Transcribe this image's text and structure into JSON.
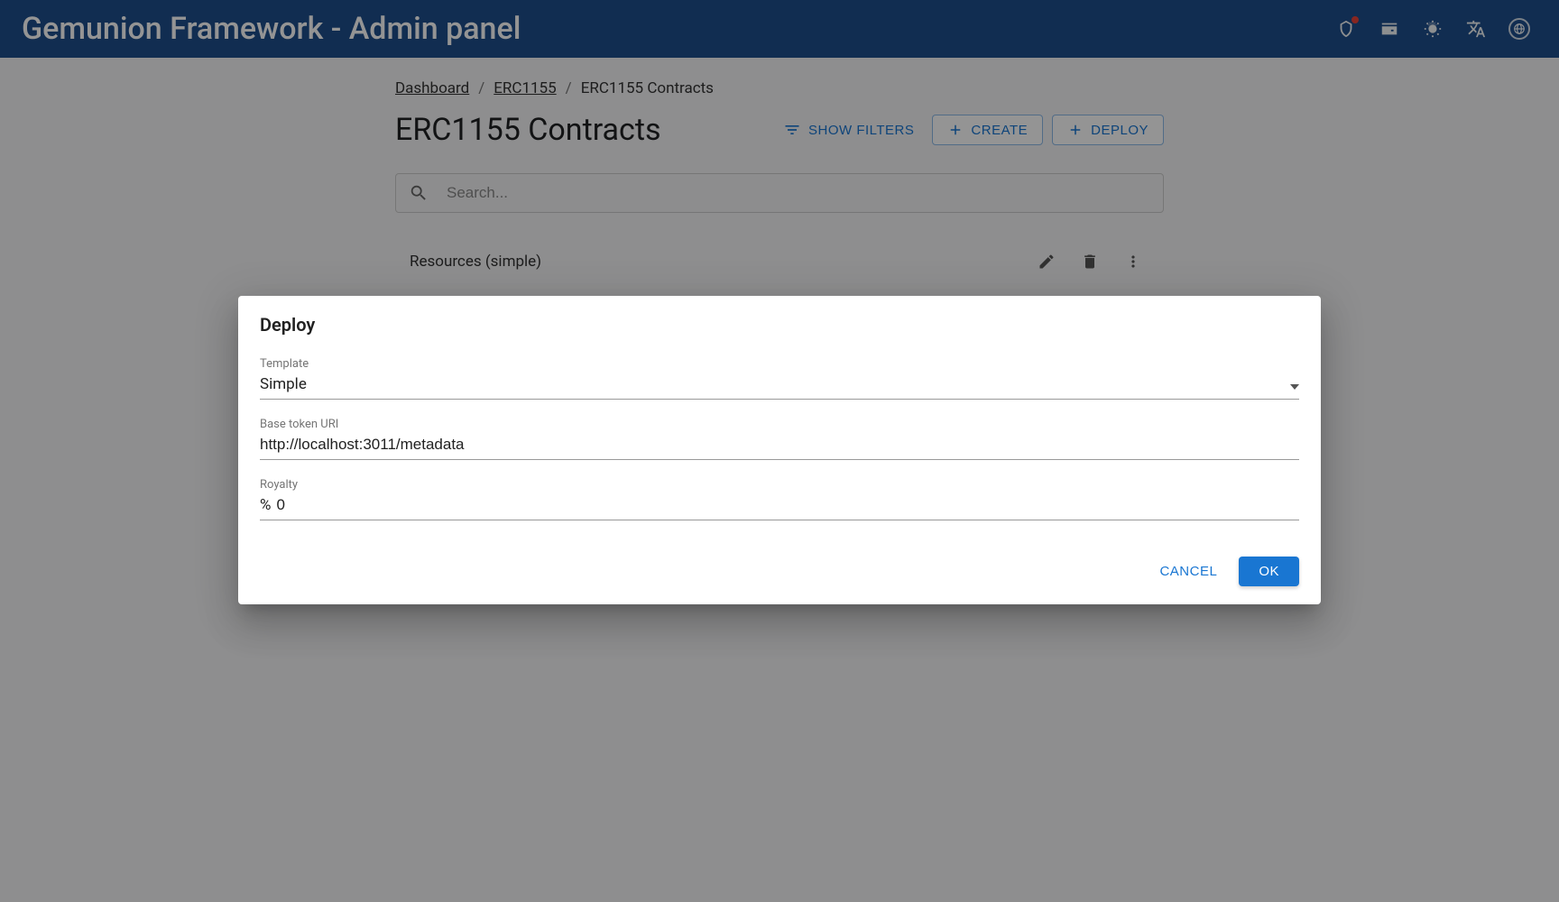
{
  "appbar": {
    "title": "Gemunion Framework - Admin panel"
  },
  "breadcrumbs": {
    "items": [
      "Dashboard",
      "ERC1155",
      "ERC1155 Contracts"
    ]
  },
  "page": {
    "title": "ERC1155 Contracts",
    "show_filters_label": "SHOW FILTERS",
    "create_label": "CREATE",
    "deploy_label": "DEPLOY",
    "search_placeholder": "Search..."
  },
  "list": {
    "items": [
      {
        "label": "Resources (simple)"
      }
    ]
  },
  "dialog": {
    "title": "Deploy",
    "fields": {
      "template": {
        "label": "Template",
        "value": "Simple"
      },
      "base_uri": {
        "label": "Base token URI",
        "value": "http://localhost:3011/metadata"
      },
      "royalty": {
        "label": "Royalty",
        "prefix": "%",
        "value": "0"
      }
    },
    "cancel_label": "CANCEL",
    "ok_label": "OK"
  }
}
